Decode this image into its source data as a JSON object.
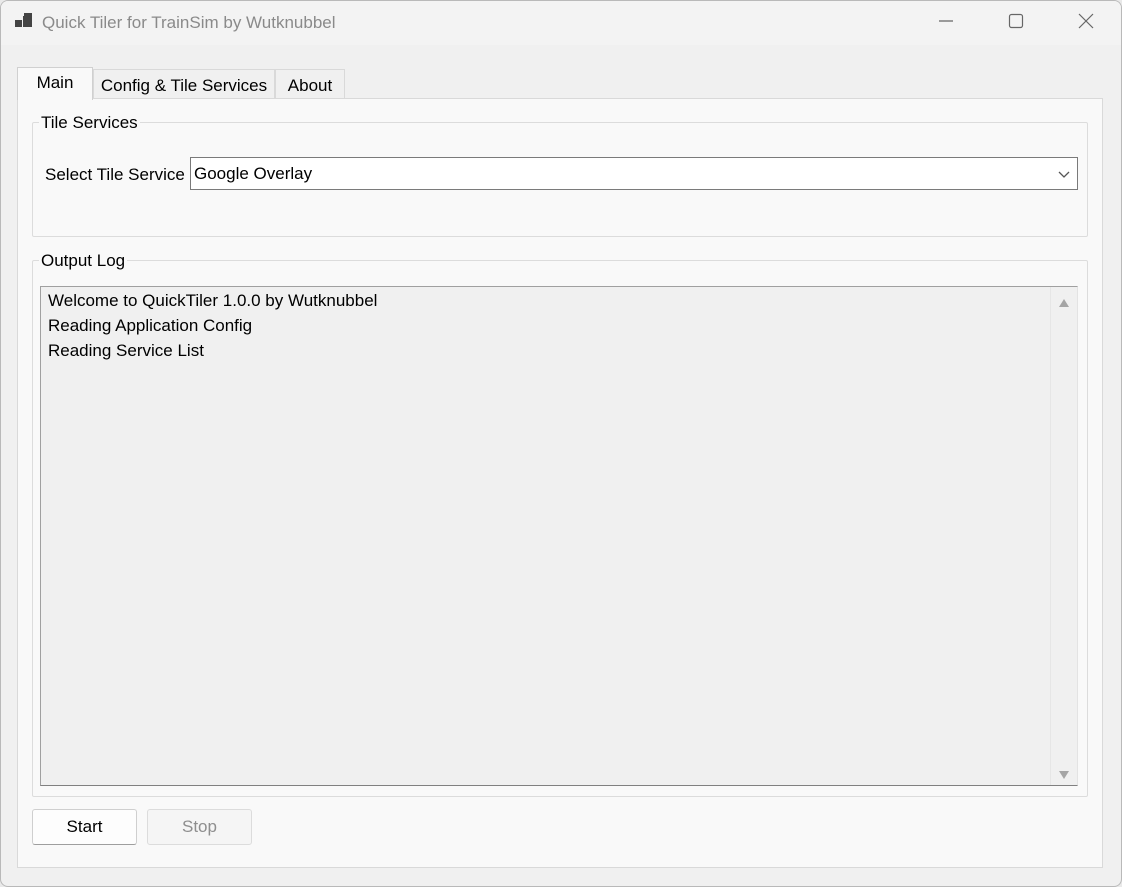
{
  "window": {
    "title": "Quick Tiler for TrainSim by Wutknubbel"
  },
  "tabs": [
    {
      "label": "Main",
      "active": true
    },
    {
      "label": "Config & Tile Services",
      "active": false
    },
    {
      "label": "About",
      "active": false
    }
  ],
  "tile_services": {
    "group_title": "Tile Services",
    "select_label": "Select Tile Service",
    "selected_value": "Google Overlay"
  },
  "output_log": {
    "group_title": "Output Log",
    "lines": [
      "Welcome to QuickTiler 1.0.0 by Wutknubbel",
      "Reading Application Config",
      "Reading Service List"
    ]
  },
  "buttons": {
    "start_label": "Start",
    "stop_label": "Stop"
  },
  "icons": {
    "app": "app-windows-icon",
    "minimize": "minimize-icon",
    "maximize": "maximize-icon",
    "close": "close-icon",
    "dropdown": "chevron-down-icon",
    "scroll_up": "scroll-up-arrow-icon",
    "scroll_down": "scroll-down-arrow-icon"
  }
}
